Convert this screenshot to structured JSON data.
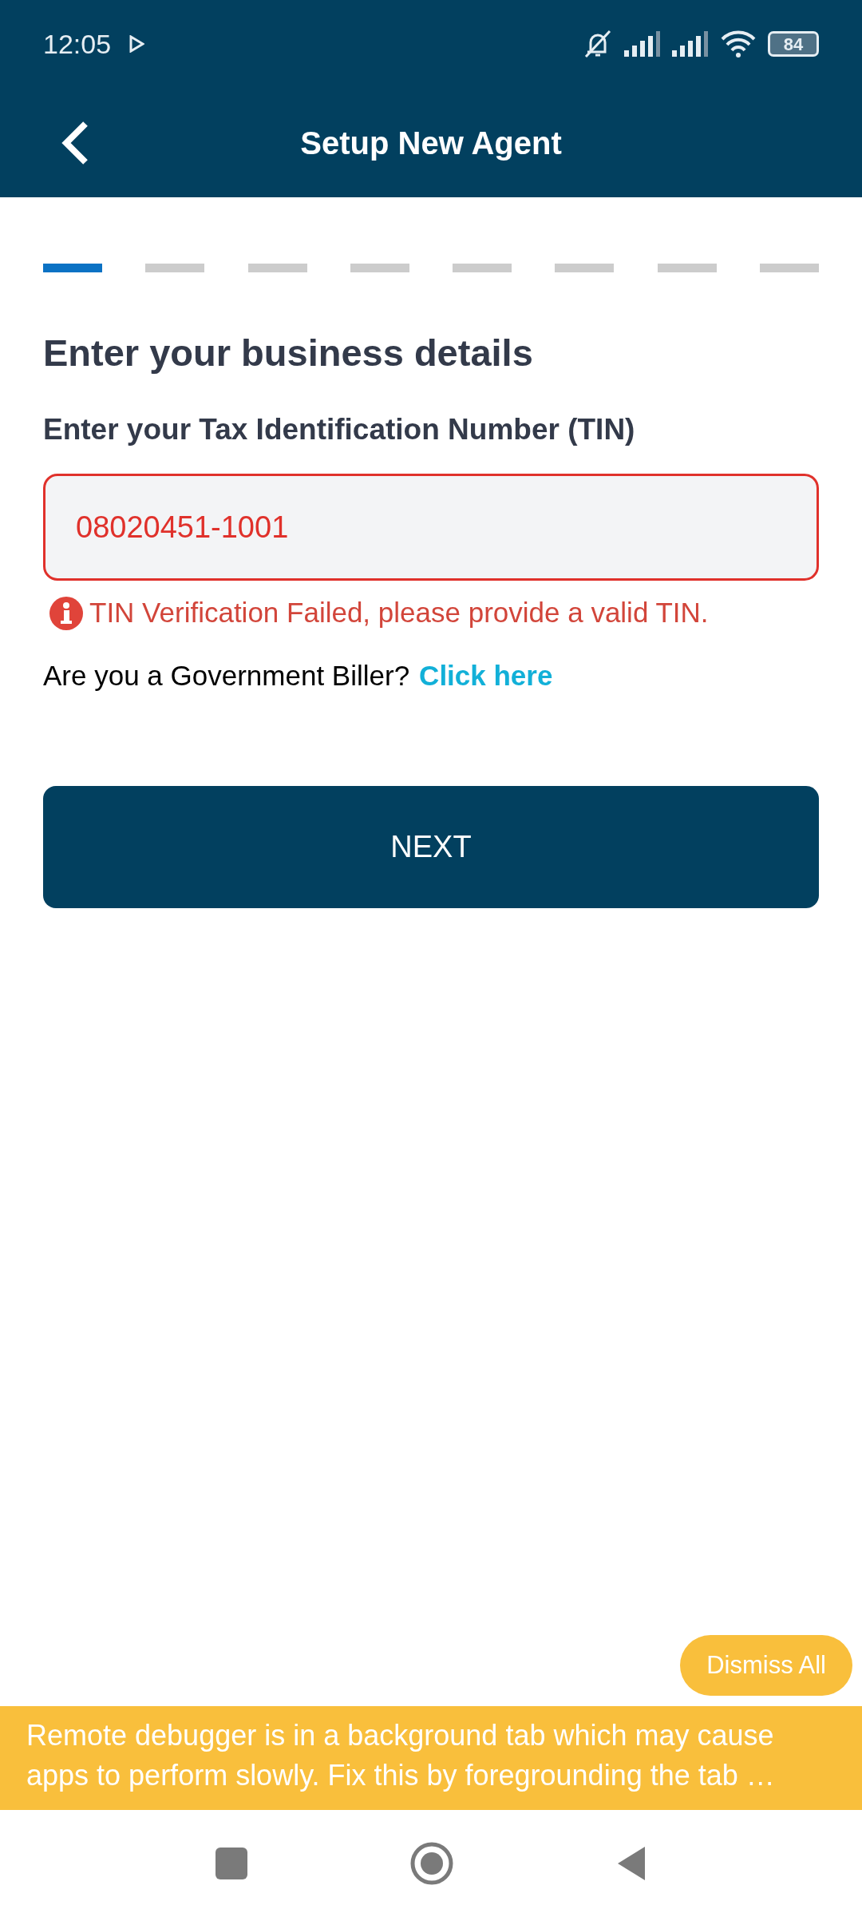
{
  "status_bar": {
    "time": "12:05",
    "battery": "84"
  },
  "app_bar": {
    "title": "Setup New Agent"
  },
  "steps": [
    {
      "selected": true
    },
    {
      "selected": false
    },
    {
      "selected": false
    },
    {
      "selected": false
    },
    {
      "selected": false
    },
    {
      "selected": false
    },
    {
      "selected": false
    },
    {
      "selected": false
    }
  ],
  "heading": "Enter your business details",
  "tin_field": {
    "label": "Enter your Tax Identification Number (TIN)",
    "value": "08020451-1001",
    "error": "TIN Verification Failed, please provide a valid TIN."
  },
  "biller_prompt": {
    "text": "Are you a Government Biller?",
    "link": "Click here"
  },
  "next_button": "NEXT",
  "debugger": {
    "dismiss": "Dismiss All",
    "message": "Remote debugger is in a background tab which may cause apps to perform slowly. Fix this by foregrounding the tab …"
  }
}
